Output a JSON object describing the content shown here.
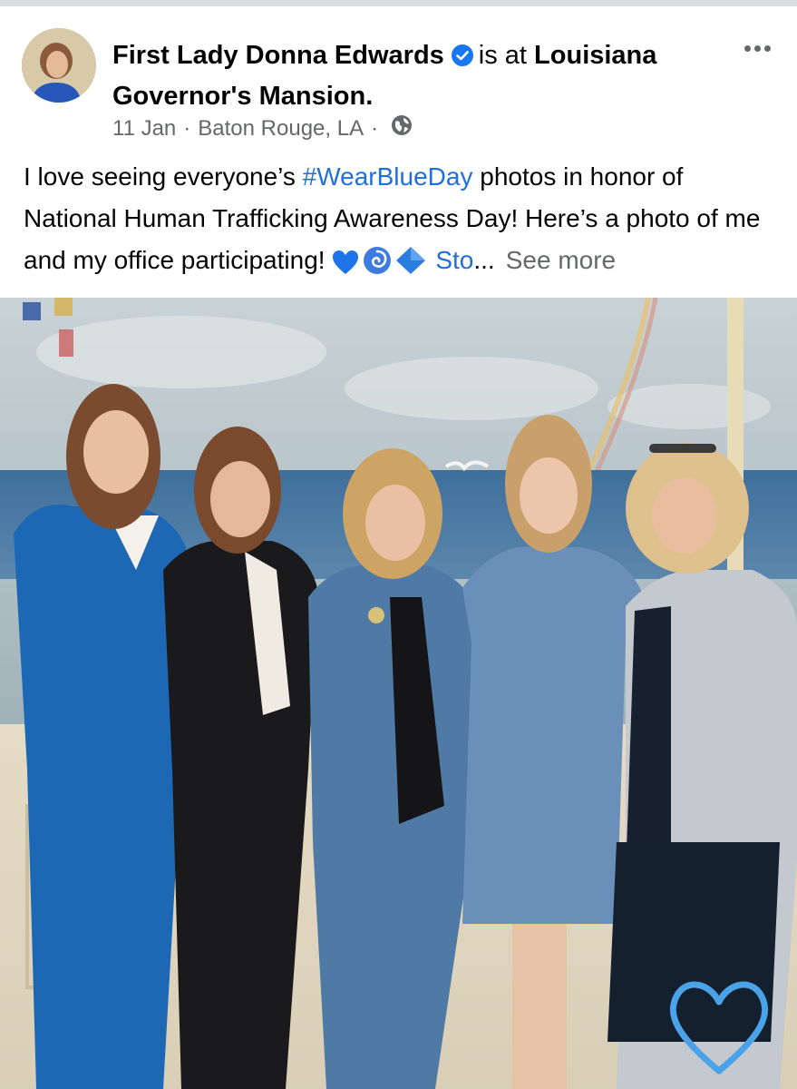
{
  "post": {
    "author": "First Lady Donna Edwards",
    "at_text": "is at",
    "location_line1": "Louisiana",
    "location_line2": "Governor's Mansion.",
    "date": "11 Jan",
    "sep1": "·",
    "city": "Baton Rouge, LA",
    "sep2": "·",
    "text_part1": "I love seeing everyone’s ",
    "hashtag": "#WearBlueDay",
    "text_part2": " photos in honor of National Human Trafficking Awareness Day! Here’s a photo of me and my office participating! ",
    "truncated_link": "Sto",
    "ellipsis": "...",
    "see_more": "See more"
  },
  "icons": {
    "verified": "verified-badge-icon",
    "globe": "globe-icon",
    "more": "more-options-icon",
    "emojis": [
      "blue-heart-emoji",
      "cyclone-emoji",
      "blue-diamond-emoji"
    ]
  },
  "colors": {
    "link": "#216fdb",
    "secondary_text": "#65676b",
    "verified": "#1877f2"
  }
}
